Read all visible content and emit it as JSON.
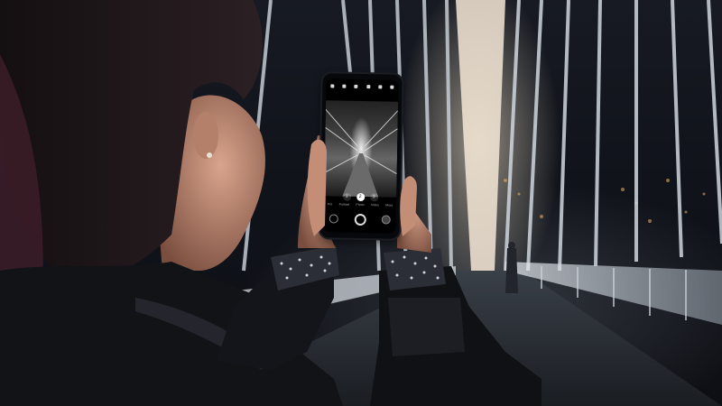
{
  "image": {
    "kind": "photo",
    "colors": {
      "background": "#0b0d12",
      "bridge_light": "#f3e6d4",
      "cables": "#cfd6de",
      "jacket": "#121317",
      "hair": "#1a1416",
      "skin": "#c8917a",
      "phone": "#07080b"
    }
  },
  "phone_ui": {
    "zoom_options": [
      "1",
      "2",
      "3"
    ],
    "active_zoom": "1",
    "modes": [
      "Pro",
      "Portrait",
      "Photo",
      "Video",
      "More"
    ],
    "icons": [
      "flash-icon",
      "hdr-icon",
      "timer-icon",
      "ratio-icon",
      "filter-icon",
      "settings-icon"
    ]
  }
}
